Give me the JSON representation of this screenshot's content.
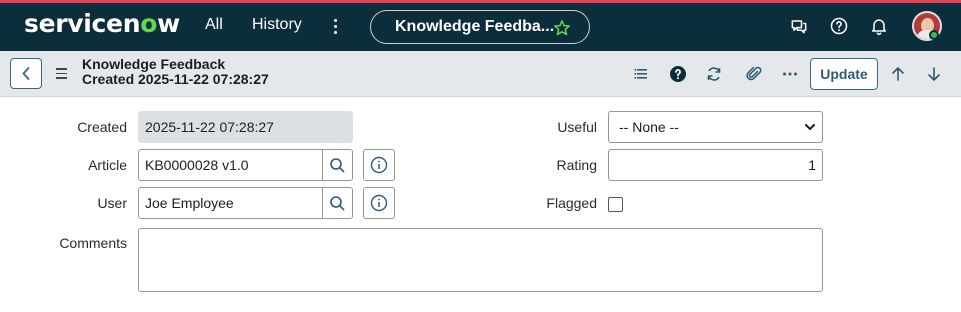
{
  "nav": {
    "logo_pre": "servicen",
    "logo_o": "o",
    "logo_post": "w",
    "all_label": "All",
    "history_label": "History",
    "pill_label": "Knowledge Feedba...",
    "accent_color": "#62d84e"
  },
  "header": {
    "title": "Knowledge Feedback",
    "subtitle": "Created 2025-11-22 07:28:27",
    "update_label": "Update"
  },
  "form": {
    "created": {
      "label": "Created",
      "value": "2025-11-22 07:28:27"
    },
    "article": {
      "label": "Article",
      "value": "KB0000028 v1.0"
    },
    "user": {
      "label": "User",
      "value": "Joe Employee"
    },
    "comments": {
      "label": "Comments",
      "value": ""
    },
    "useful": {
      "label": "Useful",
      "value": "-- None --"
    },
    "rating": {
      "label": "Rating",
      "value": "1"
    },
    "flagged": {
      "label": "Flagged",
      "checked": false
    }
  }
}
